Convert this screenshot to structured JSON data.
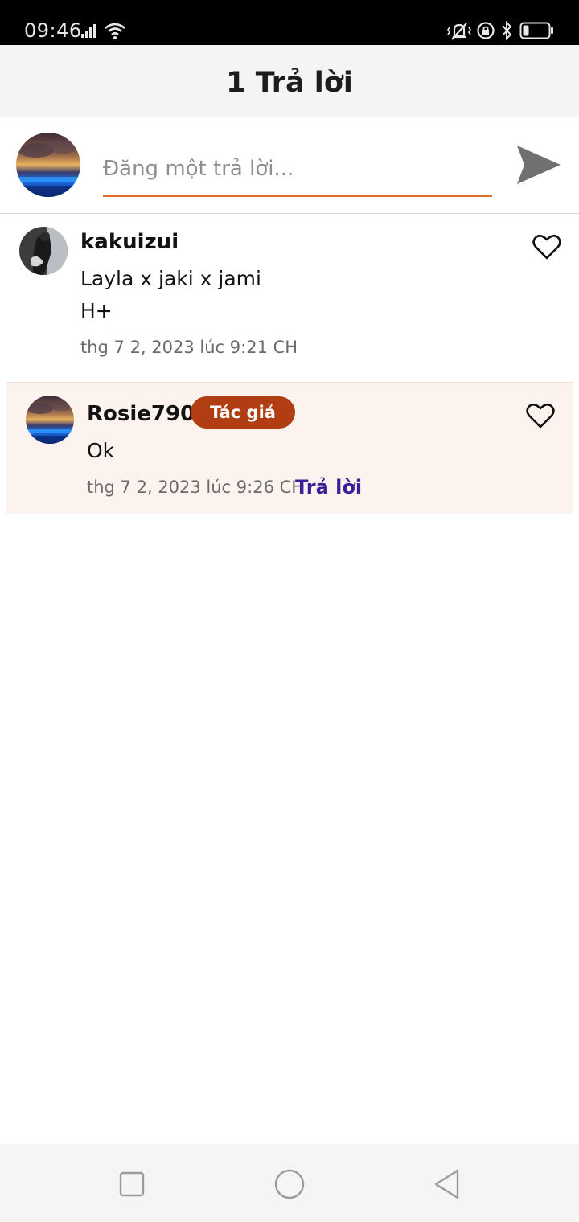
{
  "status_bar": {
    "time": "09:46",
    "icons": [
      "signal-icon",
      "wifi-icon",
      "vibrate-icon",
      "rotation-lock-icon",
      "bluetooth-icon",
      "battery-icon"
    ]
  },
  "header": {
    "title": "1 Trả lời"
  },
  "composer": {
    "placeholder": "Đăng một trả lời...",
    "value": "",
    "accent_color": "#e2712f"
  },
  "comment": {
    "username": "kakuizui",
    "lines": [
      "Layla x jaki x jami",
      "H+"
    ],
    "timestamp": "thg 7 2, 2023 lúc 9:21 CH",
    "liked": false
  },
  "reply": {
    "username": "Rosie790",
    "badge": "Tác giả",
    "text": "Ok",
    "timestamp": "thg 7 2, 2023 lúc 9:26 CH",
    "reply_label": "Trả lời",
    "liked": false,
    "background_color": "#fdf3ee",
    "badge_color": "#b03e12",
    "link_color": "#3b1e9a"
  },
  "nav_bar": {
    "buttons": [
      "recent-apps-icon",
      "home-icon",
      "back-icon"
    ]
  }
}
